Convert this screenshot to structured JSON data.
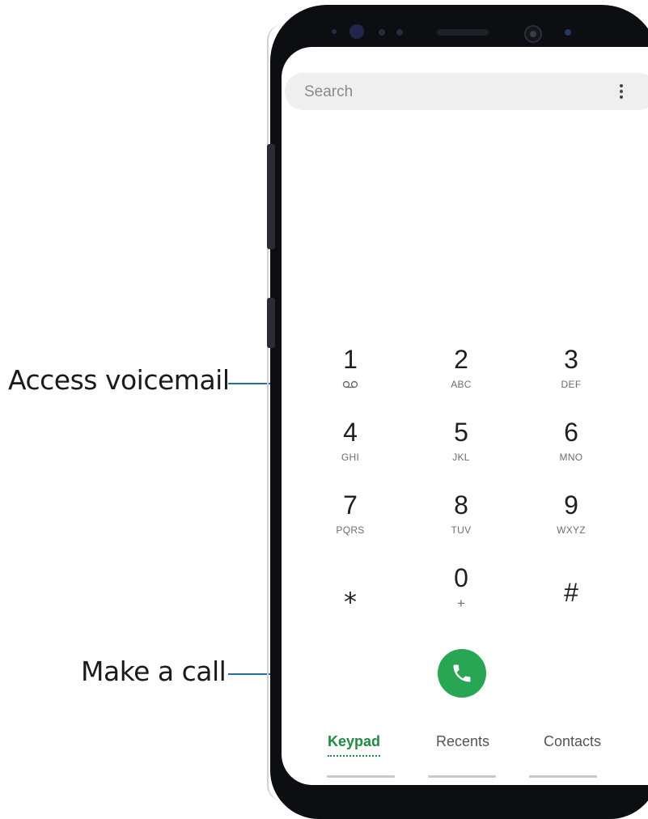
{
  "callouts": {
    "voicemail": "Access voicemail",
    "call": "Make a call"
  },
  "search": {
    "placeholder": "Search"
  },
  "keypad": {
    "keys": [
      {
        "digit": "1",
        "sub": ""
      },
      {
        "digit": "2",
        "sub": "ABC"
      },
      {
        "digit": "3",
        "sub": "DEF"
      },
      {
        "digit": "4",
        "sub": "GHI"
      },
      {
        "digit": "5",
        "sub": "JKL"
      },
      {
        "digit": "6",
        "sub": "MNO"
      },
      {
        "digit": "7",
        "sub": "PQRS"
      },
      {
        "digit": "8",
        "sub": "TUV"
      },
      {
        "digit": "9",
        "sub": "WXYZ"
      },
      {
        "digit": "⁎",
        "sub": ""
      },
      {
        "digit": "0",
        "sub": "+"
      },
      {
        "digit": "#",
        "sub": ""
      }
    ]
  },
  "tabs": [
    {
      "label": "Keypad",
      "active": true
    },
    {
      "label": "Recents",
      "active": false
    },
    {
      "label": "Contacts",
      "active": false
    }
  ],
  "icons": {
    "more": "more-vertical-icon",
    "voicemail": "voicemail-icon",
    "call": "phone-icon"
  },
  "colors": {
    "accent": "#1f8a44",
    "call_button": "#29a653",
    "callout_line": "#1f6fa5"
  }
}
